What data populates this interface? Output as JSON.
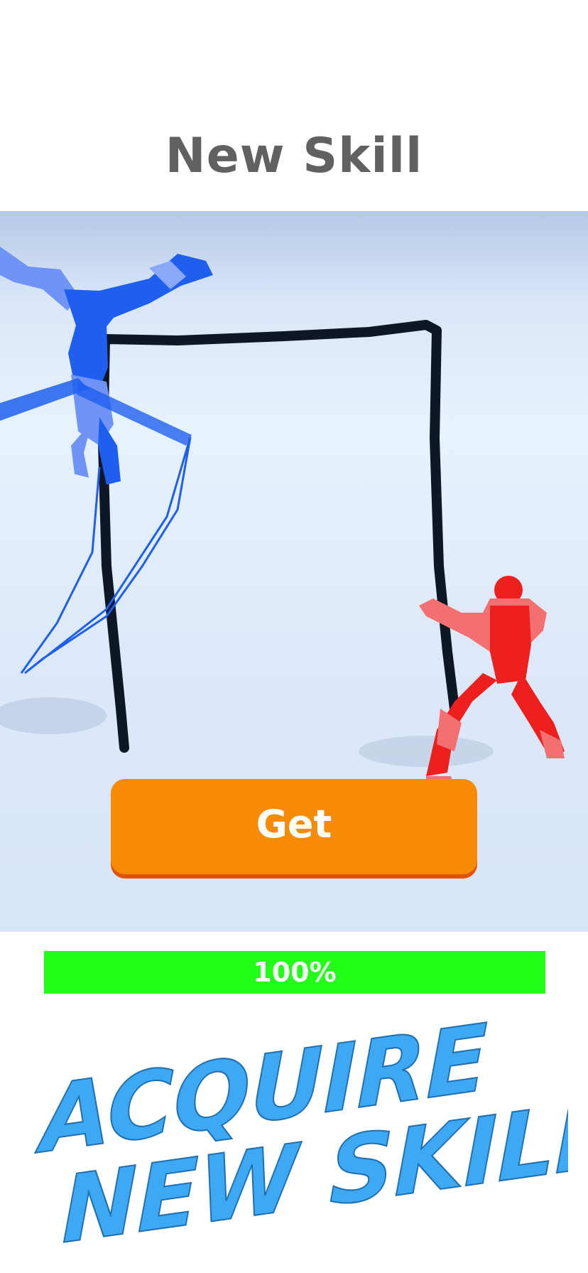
{
  "header": {
    "title": "New Skill"
  },
  "actions": {
    "get_label": "Get"
  },
  "progress": {
    "label": "100%",
    "value": 1.0
  },
  "banner": {
    "line1": "ACQUIRE",
    "line2": "NEW SKILLS!"
  },
  "colors": {
    "title": "#616161",
    "button": "#f78c04",
    "button_shadow": "#e25207",
    "progress_fill": "#22ff19",
    "banner_text": "#3da9f4",
    "blue_fighter": "#1f5ff0",
    "red_fighter": "#ee1f1f",
    "drawn_line": "#0e1726"
  }
}
